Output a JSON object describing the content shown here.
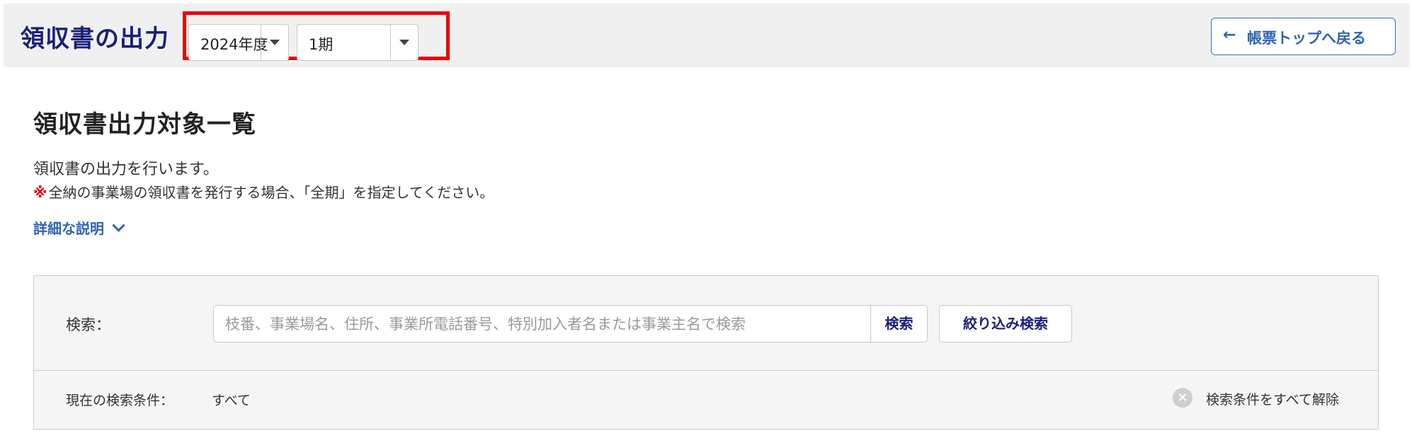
{
  "header": {
    "title": "領収書の出力",
    "fiscal_year": "2024年度",
    "period": "1期",
    "back_button_label": "帳票トップへ戻る",
    "back_arrow": "←"
  },
  "main": {
    "page_title": "領収書出力対象一覧",
    "description": "領収書の出力を行います。",
    "note_mark": "※",
    "note_text": "全納の事業場の領収書を発行する場合、「全期」を指定してください。",
    "detail_link": "詳細な説明"
  },
  "search": {
    "label": "検索：",
    "placeholder": "枝番、事業場名、住所、事業所電話番号、特別加入者名または事業主名で検索",
    "value": "",
    "search_button": "検索",
    "filter_button": "絞り込み検索",
    "condition_label": "現在の検索条件：",
    "condition_value": "すべて",
    "clear_button": "検索条件をすべて解除",
    "clear_icon": "×"
  },
  "colors": {
    "highlight": "#ee0000",
    "title_navy": "#1a1f7a",
    "link_blue": "#2f63b0"
  }
}
